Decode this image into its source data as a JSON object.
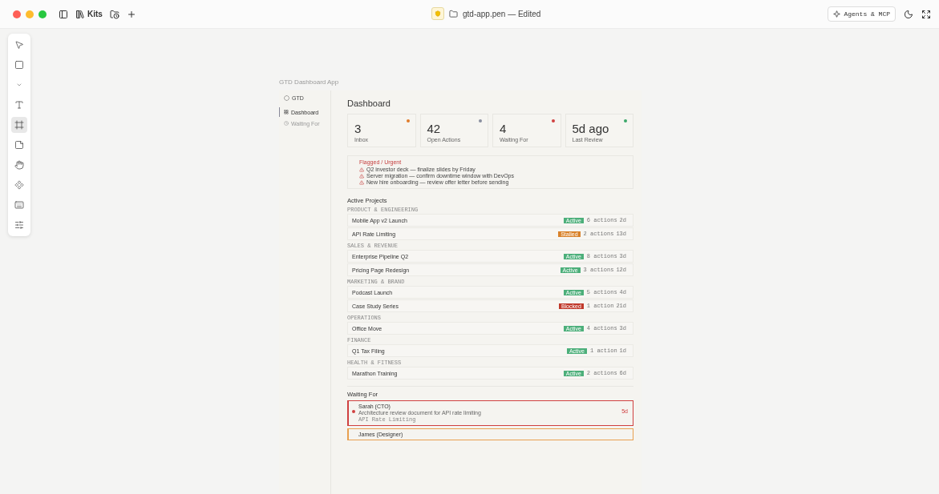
{
  "window": {
    "file_title": "gtd-app.pen — Edited",
    "kits_label": "Kits",
    "agents_button": "Agents & MCP"
  },
  "tools": [
    {
      "kind": "pointer",
      "selected": false
    },
    {
      "kind": "rectangle",
      "selected": false
    },
    {
      "kind": "chevron",
      "selected": false
    },
    {
      "kind": "text",
      "selected": false
    },
    {
      "kind": "frame",
      "selected": true
    },
    {
      "kind": "note",
      "selected": false
    },
    {
      "kind": "hand",
      "selected": false
    },
    {
      "kind": "component",
      "selected": false
    },
    {
      "kind": "keyboard",
      "selected": false
    },
    {
      "kind": "sliders",
      "selected": false
    }
  ],
  "frame_label": "GTD Dashboard App",
  "sidebar": {
    "brand": "GTD",
    "items": [
      {
        "label": "Dashboard",
        "kind": "grid",
        "selected": true
      },
      {
        "label": "Waiting For",
        "kind": "clock",
        "selected": false
      }
    ]
  },
  "page_title": "Dashboard",
  "stats": [
    {
      "value": "3",
      "label": "Inbox",
      "color": "#e07b2a"
    },
    {
      "value": "42",
      "label": "Open Actions",
      "color": "#8a8fa0"
    },
    {
      "value": "4",
      "label": "Waiting For",
      "color": "#d04040"
    },
    {
      "value": "5d ago",
      "label": "Last Review",
      "color": "#3ca86a"
    }
  ],
  "flagged": {
    "title": "Flagged / Urgent",
    "items": [
      "Q2 investor deck — finalize slides by Friday",
      "Server migration — confirm downtime window with DevOps",
      "New hire onboarding — review offer letter before sending"
    ]
  },
  "projects": {
    "title": "Active Projects",
    "groups": [
      {
        "name": "PRODUCT & ENGINEERING",
        "rows": [
          {
            "name": "Mobile App v2 Launch",
            "status": "Active",
            "kind": "active",
            "actions": "6 actions",
            "age": "2d"
          },
          {
            "name": "API Rate Limiting",
            "status": "Stalled",
            "kind": "stalled",
            "actions": "2 actions",
            "age": "13d"
          }
        ]
      },
      {
        "name": "SALES & REVENUE",
        "rows": [
          {
            "name": "Enterprise Pipeline Q2",
            "status": "Active",
            "kind": "active",
            "actions": "8 actions",
            "age": "3d"
          },
          {
            "name": "Pricing Page Redesign",
            "status": "Active",
            "kind": "active",
            "actions": "3 actions",
            "age": "12d"
          }
        ]
      },
      {
        "name": "MARKETING & BRAND",
        "rows": [
          {
            "name": "Podcast Launch",
            "status": "Active",
            "kind": "active",
            "actions": "5 actions",
            "age": "4d"
          },
          {
            "name": "Case Study Series",
            "status": "Blocked",
            "kind": "blocked",
            "actions": "1 action",
            "age": "21d"
          }
        ]
      },
      {
        "name": "OPERATIONS",
        "rows": [
          {
            "name": "Office Move",
            "status": "Active",
            "kind": "active",
            "actions": "4 actions",
            "age": "3d"
          }
        ]
      },
      {
        "name": "FINANCE",
        "rows": [
          {
            "name": "Q1 Tax Filing",
            "status": "Active",
            "kind": "active",
            "actions": "1 action",
            "age": "1d"
          }
        ]
      },
      {
        "name": "HEALTH & FITNESS",
        "rows": [
          {
            "name": "Marathon Training",
            "status": "Active",
            "kind": "active",
            "actions": "2 actions",
            "age": "6d"
          }
        ]
      }
    ]
  },
  "waiting": {
    "title": "Waiting For",
    "items": [
      {
        "person": "Sarah (CTO)",
        "task": "Architecture review document for API rate limiting",
        "project": "API Rate Limiting",
        "age": "5d",
        "color": "#d04040"
      },
      {
        "person": "James (Designer)",
        "color": "#e8a050"
      }
    ]
  }
}
